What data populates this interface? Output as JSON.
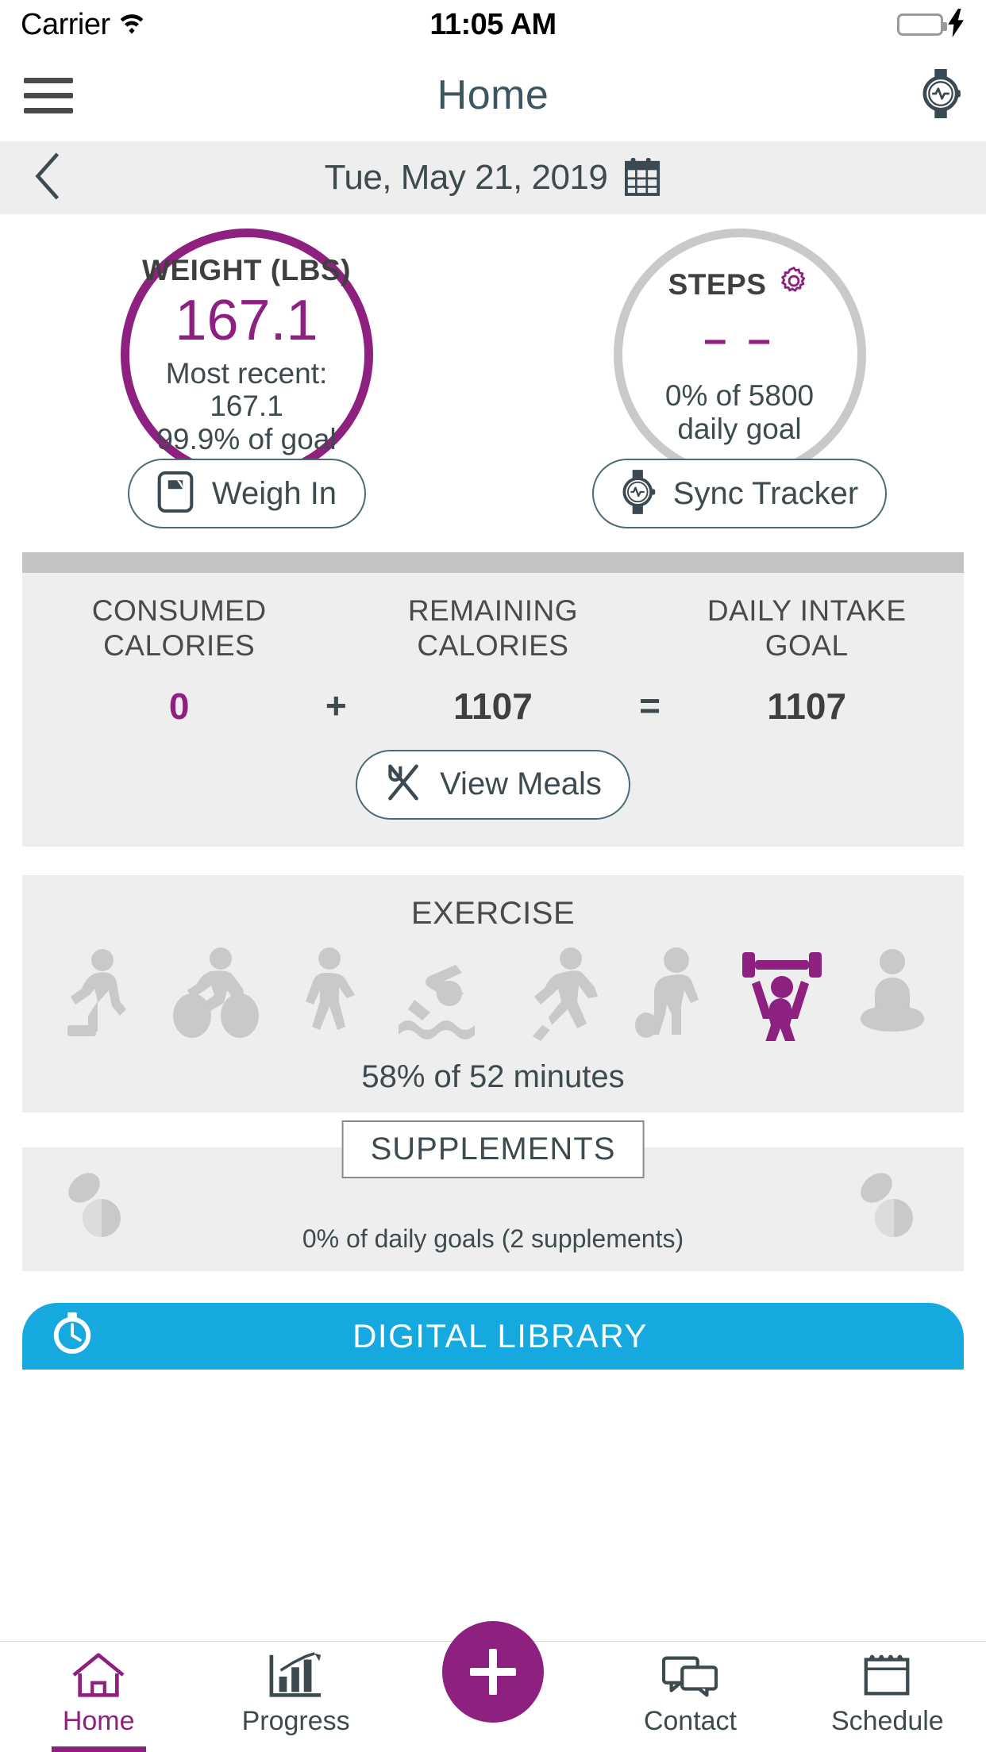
{
  "status_bar": {
    "carrier": "Carrier",
    "wifi_icon": "wifi-icon",
    "time": "11:05 AM",
    "battery_icon": "battery-full-icon",
    "charging_icon": "lightning-bolt-icon",
    "battery_color": "#3ad14f"
  },
  "nav": {
    "menu_icon": "hamburger-menu-icon",
    "title": "Home",
    "tracker_icon": "watch-tracker-icon"
  },
  "date_bar": {
    "back_icon": "chevron-left-icon",
    "date": "Tue, May 21, 2019",
    "calendar_icon": "calendar-icon"
  },
  "weight": {
    "title": "WEIGHT (LBS)",
    "value": "167.1",
    "most_recent": "Most recent: 167.1",
    "goal_percent": "99.9% of goal",
    "ring_color": "#8e2080",
    "button_label": "Weigh In",
    "button_icon": "scale-icon"
  },
  "steps": {
    "title": "STEPS",
    "settings_icon": "gear-icon",
    "value": "– –",
    "goal_line1": "0% of 5800",
    "goal_line2": "daily goal",
    "ring_color": "#c9c9c9",
    "button_label": "Sync Tracker",
    "button_icon": "watch-tracker-icon"
  },
  "calories": {
    "headers": [
      "CONSUMED CALORIES",
      "REMAINING CALORIES",
      "DAILY INTAKE GOAL"
    ],
    "header_lines": [
      [
        "CONSUMED",
        "CALORIES"
      ],
      [
        "REMAINING",
        "CALORIES"
      ],
      [
        "DAILY INTAKE",
        "GOAL"
      ]
    ],
    "consumed": "0",
    "operator_plus": "+",
    "remaining": "1107",
    "operator_equals": "=",
    "goal": "1107",
    "consumed_color": "#8e2080",
    "button_label": "View Meals",
    "button_icon": "utensils-icon"
  },
  "exercise": {
    "title": "EXERCISE",
    "icons": [
      "step-aerobics-icon",
      "cycling-icon",
      "walking-icon",
      "swimming-icon",
      "running-icon",
      "soccer-icon",
      "weightlifting-icon",
      "yoga-icon"
    ],
    "active_index": 6,
    "active_color": "#8e2080",
    "inactive_color": "#c9c9c9",
    "summary": "58% of 52 minutes"
  },
  "supplements": {
    "title": "SUPPLEMENTS",
    "left_icon": "pills-icon",
    "right_icon": "pills-icon",
    "summary": "0% of daily goals (2 supplements)"
  },
  "library": {
    "label": "DIGITAL LIBRARY",
    "icon": "stopwatch-icon",
    "background_color": "#15a9e0"
  },
  "tabbar": {
    "items": [
      {
        "label": "Home",
        "icon": "home-icon",
        "active": true
      },
      {
        "label": "Progress",
        "icon": "bar-chart-icon",
        "active": false
      },
      {
        "label": "",
        "icon": "plus-icon",
        "active": false
      },
      {
        "label": "Contact",
        "icon": "chat-bubbles-icon",
        "active": false
      },
      {
        "label": "Schedule",
        "icon": "calendar-days-icon",
        "active": false
      }
    ],
    "accent_color": "#8e2080"
  }
}
